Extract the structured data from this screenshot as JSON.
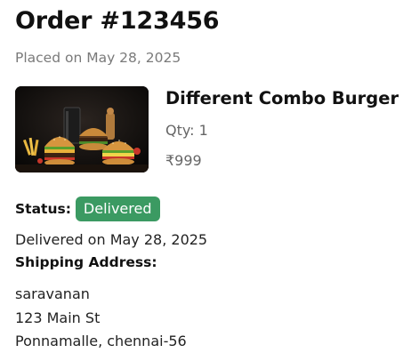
{
  "order": {
    "title": "Order #123456",
    "placed_on": "Placed on May 28, 2025"
  },
  "item": {
    "image_icon": "burger-combo-photo",
    "name": "Different Combo Burger",
    "quantity": "Qty: 1",
    "price": "₹999"
  },
  "status": {
    "label": "Status:",
    "badge": "Delivered",
    "badge_color": "#3b9a62",
    "delivered_on": "Delivered on May 28, 2025"
  },
  "shipping": {
    "label": "Shipping Address:",
    "lines": [
      "saravanan",
      "123 Main St",
      "Ponnamalle, chennai-56"
    ]
  }
}
